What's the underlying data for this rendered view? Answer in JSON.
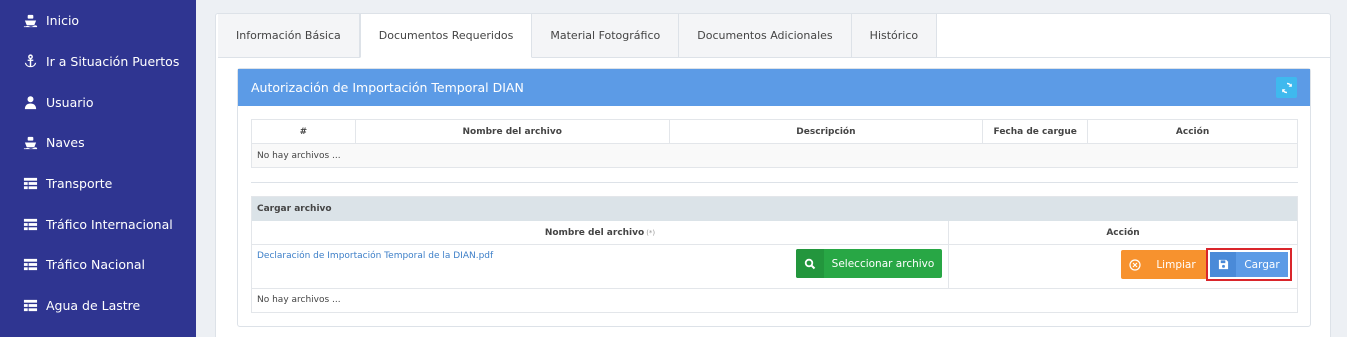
{
  "sidebar": {
    "items": [
      {
        "label": "Inicio",
        "icon": "ship-icon"
      },
      {
        "label": "Ir a Situación Puertos",
        "icon": "anchor-icon"
      },
      {
        "label": "Usuario",
        "icon": "user-icon"
      },
      {
        "label": "Naves",
        "icon": "ship-icon"
      },
      {
        "label": "Transporte",
        "icon": "table-icon"
      },
      {
        "label": "Tráfico Internacional",
        "icon": "table-icon"
      },
      {
        "label": "Tráfico Nacional",
        "icon": "table-icon"
      },
      {
        "label": "Agua de Lastre",
        "icon": "table-icon"
      }
    ]
  },
  "tabs": [
    {
      "label": "Información Básica"
    },
    {
      "label": "Documentos Requeridos"
    },
    {
      "label": "Material Fotográfico"
    },
    {
      "label": "Documentos Adicionales"
    },
    {
      "label": "Histórico"
    }
  ],
  "panel": {
    "title": "Autorización de Importación Temporal DIAN"
  },
  "files_table": {
    "headers": [
      "#",
      "Nombre del archivo",
      "Descripción",
      "Fecha de cargue",
      "Acción"
    ],
    "empty_text": "No hay archivos ..."
  },
  "upload": {
    "title": "Cargar archivo",
    "col_name": "Nombre del archivo",
    "required_mark": "(*)",
    "col_action": "Acción",
    "file_name": "Declaración de Importación Temporal de la DIAN.pdf",
    "select_label": "Seleccionar archivo",
    "clean_label": "Limpiar",
    "load_label": "Cargar",
    "empty_text": "No hay archivos ..."
  },
  "colors": {
    "sidebar": "#2f3591",
    "panel_header": "#5c9be6",
    "select_button": "#28a745",
    "clean_button": "#f7922e",
    "highlight": "#d9252b"
  }
}
